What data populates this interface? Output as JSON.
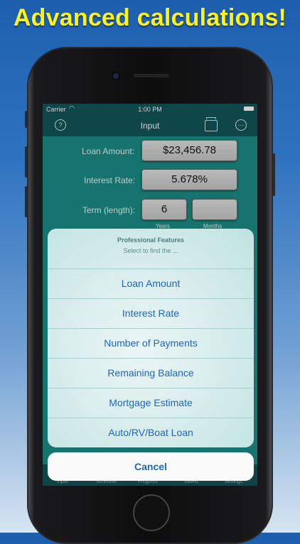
{
  "headline": "Advanced calculations!",
  "status": {
    "carrier": "Carrier",
    "time": "1:00 PM"
  },
  "nav": {
    "title": "Input"
  },
  "form": {
    "loan_amount_label": "Loan Amount:",
    "loan_amount_value": "$23,456.78",
    "interest_rate_label": "Interest Rate:",
    "interest_rate_value": "5.678%",
    "term_label": "Term (length):",
    "term_years_value": "6",
    "term_months_value": "",
    "years_label": "Years",
    "months_label": "Months"
  },
  "sheet": {
    "title": "Professional Features",
    "subtitle": "Select to find the ...",
    "options": [
      "Loan Amount",
      "Interest Rate",
      "Number of Payments",
      "Remaining Balance",
      "Mortgage Estimate",
      "Auto/RV/Boat Loan"
    ],
    "cancel": "Cancel"
  },
  "tabs": [
    "Input",
    "Schedule",
    "Progress",
    "Saved",
    "Settings"
  ],
  "icons": [
    "help-icon",
    "stack-icon",
    "more-icon",
    "wifi-icon",
    "battery-icon"
  ],
  "colors": {
    "headline": "#fff21c",
    "accent": "#1a67c9",
    "teal": "#1b8d86",
    "navbar": "#12565a"
  }
}
